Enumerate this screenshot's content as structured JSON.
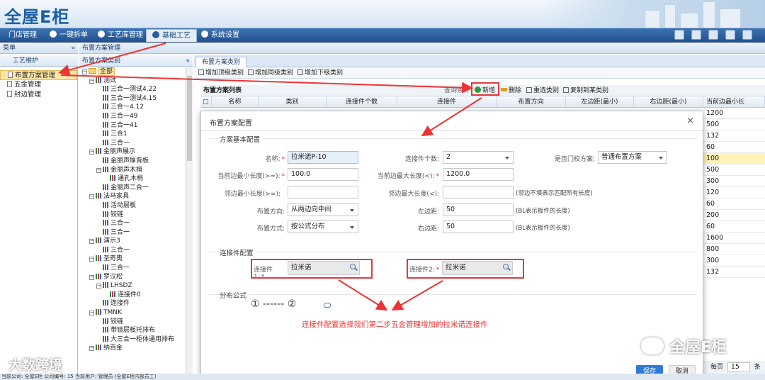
{
  "app": {
    "logo": "全屋E柜"
  },
  "menubar": {
    "tabs": [
      {
        "label": "门店管理",
        "name": "tab-store-management"
      },
      {
        "label": "一键拆单",
        "name": "tab-one-click-split"
      },
      {
        "label": "工艺库管理",
        "name": "tab-process-library"
      },
      {
        "label": "基础工艺",
        "name": "tab-basic-process"
      },
      {
        "label": "系统设置",
        "name": "tab-system-settings"
      }
    ]
  },
  "left": {
    "menu_title": "菜单",
    "section_title": "工艺维护",
    "items": [
      "布置方案管理",
      "五金管理",
      "封边管理"
    ]
  },
  "breadcrumb": "布置方案管理",
  "tree": {
    "title": "布置方案类别",
    "nodes": [
      {
        "t": "全部",
        "d": 0,
        "type": "root"
      },
      {
        "t": "测试",
        "d": 1,
        "type": "cat"
      },
      {
        "t": "三合一测试4.22",
        "d": 2,
        "type": "leaf"
      },
      {
        "t": "三合一测试4.15",
        "d": 2,
        "type": "leaf"
      },
      {
        "t": "三合一4.12",
        "d": 2,
        "type": "leaf"
      },
      {
        "t": "三合一49",
        "d": 2,
        "type": "leaf"
      },
      {
        "t": "三合一41",
        "d": 2,
        "type": "leaf"
      },
      {
        "t": "三合1",
        "d": 2,
        "type": "leaf"
      },
      {
        "t": "三合一",
        "d": 2,
        "type": "leaf"
      },
      {
        "t": "金丽声展示",
        "d": 1,
        "type": "cat"
      },
      {
        "t": "金丽声厚背板",
        "d": 2,
        "type": "leaf"
      },
      {
        "t": "金丽声木梢",
        "d": 2,
        "type": "cat"
      },
      {
        "t": "通孔木梢",
        "d": 3,
        "type": "leaf"
      },
      {
        "t": "金丽声二合一",
        "d": 2,
        "type": "leaf"
      },
      {
        "t": "法马家具",
        "d": 1,
        "type": "cat"
      },
      {
        "t": "活动层板",
        "d": 2,
        "type": "leaf"
      },
      {
        "t": "铰链",
        "d": 2,
        "type": "leaf"
      },
      {
        "t": "三合一",
        "d": 2,
        "type": "leaf"
      },
      {
        "t": "三合一",
        "d": 2,
        "type": "leaf"
      },
      {
        "t": "演示3",
        "d": 1,
        "type": "cat"
      },
      {
        "t": "三合一",
        "d": 2,
        "type": "leaf"
      },
      {
        "t": "圣奇奥",
        "d": 1,
        "type": "cat"
      },
      {
        "t": "三合一",
        "d": 2,
        "type": "leaf"
      },
      {
        "t": "罗汉松",
        "d": 1,
        "type": "cat"
      },
      {
        "t": "LHSDZ",
        "d": 2,
        "type": "cat"
      },
      {
        "t": "连接件0",
        "d": 3,
        "type": "leaf"
      },
      {
        "t": "连接件",
        "d": 2,
        "type": "leaf"
      },
      {
        "t": "TMNK",
        "d": 1,
        "type": "cat"
      },
      {
        "t": "铰链",
        "d": 2,
        "type": "leaf"
      },
      {
        "t": "带锁层板托排布",
        "d": 2,
        "type": "leaf"
      },
      {
        "t": "大三合一柜体通用排布",
        "d": 2,
        "type": "leaf"
      },
      {
        "t": "纳百金",
        "d": 1,
        "type": "cat"
      }
    ]
  },
  "main": {
    "tab": "布置方案类别",
    "toolbar": [
      "增加顶级类别",
      "增加同级类别",
      "增加下级类别"
    ],
    "grid_title": "布置方案列表",
    "query_label": "查询条件",
    "actions": [
      "新增",
      "删除",
      "重选类别",
      "复制到某类别"
    ],
    "columns": [
      "名称",
      "类别",
      "连接件个数",
      "连接件",
      "布置方向",
      "左边距(最小)",
      "右边距(最小)",
      "当前边最小长"
    ],
    "right_values": [
      "1200",
      "500",
      "132",
      "60",
      "100",
      "500",
      "300",
      "120",
      "60",
      "200",
      "60",
      "1600",
      "800",
      "300",
      "132"
    ],
    "pager": {
      "per_page_label": "每页",
      "per_page": "15",
      "rest": "条"
    }
  },
  "modal": {
    "title": "布置方案配置",
    "close": "×",
    "sections": [
      "方案基本配置",
      "连接件配置",
      "分布公式"
    ],
    "fields": {
      "name_label": "名称:",
      "name_value": "拉米诺P-10",
      "count_label": "连接件个数:",
      "count_value": "2",
      "door_label": "是否门校方案:",
      "door_value": "普通布置方案",
      "minlen_label": "当前边最小长度(>=):",
      "minlen_value": "100.0",
      "maxlen_label": "当前边最大长度(<):",
      "maxlen_value": "1200.0",
      "nbmin_label": "邻边最小长度(>=):",
      "nbmin_value": "",
      "nbmax_label": "邻边最大长度(<):",
      "nbmax_value": "",
      "nbmax_hint": "(邻边不填表示匹配所有长度)",
      "dir_label": "布置方向:",
      "dir_value": "从两边向中间",
      "left_label": "左边距:",
      "left_value": "50",
      "left_hint": "(BL表示板件的长度)",
      "mode_label": "布置方式:",
      "mode_value": "按公式分布",
      "right_label": "右边距:",
      "right_value": "50",
      "right_hint": "(BL表示板件的长度)"
    },
    "conn1_label": "连接件1:",
    "conn1_value": "拉米诺",
    "conn2_label": "连接件2:",
    "conn2_value": "拉米诺",
    "formula": "① ------ ②",
    "annotation": "连接件配置选择我们第二步五金管理增加的拉米诺连接件",
    "save": "保存",
    "cancel": "取消"
  },
  "statusbar": "当前公司: 全屋E柜   公司编号: 15   当前用户: 管理员 (全屋E柜内部员工)",
  "watermarks": [
    "大数跨境",
    "全屋E柜"
  ],
  "colors": {
    "accent": "#2f7ad6",
    "annotation": "#e33333",
    "menubar": "#22518f"
  }
}
